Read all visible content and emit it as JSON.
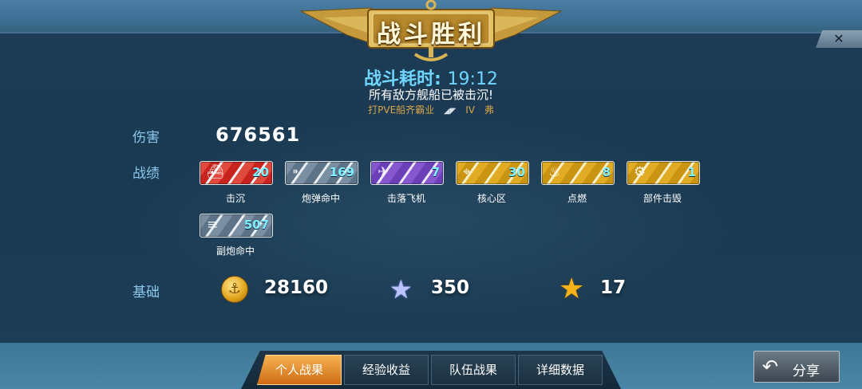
{
  "title": "战斗胜利",
  "close_icon": "✕",
  "battle_time_label": "战斗耗时:",
  "battle_time_value": "19:12",
  "result_text": "所有敌方舰船已被击沉!",
  "mode": {
    "name": "打PVE船齐霸业",
    "tier": "IV",
    "ship": "弗"
  },
  "labels": {
    "damage": "伤害",
    "stats": "战绩",
    "base": "基础"
  },
  "damage_value": "676561",
  "stats": [
    {
      "caption": "击沉",
      "value": "20",
      "style": "red",
      "icon": "sunk-ship-icon",
      "glyph": "⛴"
    },
    {
      "caption": "炮弹命中",
      "value": "169",
      "style": "steel",
      "icon": "shell-hit-icon",
      "glyph": "⁍"
    },
    {
      "caption": "击落飞机",
      "value": "7",
      "style": "purple",
      "icon": "plane-down-icon",
      "glyph": "✈"
    },
    {
      "caption": "核心区",
      "value": "30",
      "style": "gold",
      "icon": "citadel-icon",
      "glyph": "⌖"
    },
    {
      "caption": "点燃",
      "value": "8",
      "style": "gold",
      "icon": "fire-icon",
      "glyph": "♨"
    },
    {
      "caption": "部件击毁",
      "value": "1",
      "style": "gold",
      "icon": "gear-icon",
      "glyph": "⚙"
    },
    {
      "caption": "副炮命中",
      "value": "507",
      "style": "steel",
      "icon": "secondary-gun-icon",
      "glyph": "≡"
    }
  ],
  "base": {
    "credits": "28160",
    "exp": "350",
    "elite_exp": "17"
  },
  "tabs": [
    {
      "label": "个人战果",
      "active": true
    },
    {
      "label": "经验收益",
      "active": false
    },
    {
      "label": "队伍战果",
      "active": false
    },
    {
      "label": "详细数据",
      "active": false
    }
  ],
  "share_label": "分享"
}
